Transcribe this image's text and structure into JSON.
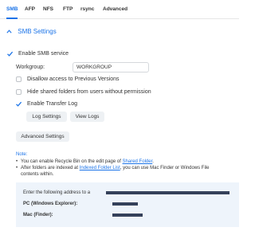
{
  "tabs": [
    {
      "label": "SMB",
      "active": true
    },
    {
      "label": "AFP",
      "active": false
    },
    {
      "label": "NFS",
      "active": false
    },
    {
      "label": "FTP",
      "active": false
    },
    {
      "label": "rsync",
      "active": false
    },
    {
      "label": "Advanced",
      "active": false
    }
  ],
  "section": {
    "title": "SMB Settings",
    "chevron_icon": "chevron-up-icon"
  },
  "settings": {
    "enable_smb": {
      "label": "Enable SMB service",
      "checked": true
    },
    "workgroup": {
      "label": "Workgroup:",
      "value": "WORKGROUP"
    },
    "disallow_previous_versions": {
      "label": "Disallow access to Previous Versions",
      "checked": false
    },
    "hide_shared_folders": {
      "label": "Hide shared folders from users without permission",
      "checked": false
    },
    "enable_transfer_log": {
      "label": "Enable Transfer Log",
      "checked": true
    },
    "log_settings_button": "Log Settings",
    "view_logs_button": "View Logs",
    "advanced_settings_button": "Advanced Settings"
  },
  "note": {
    "title": "Note:",
    "line1_prefix": "You can enable Recycle Bin on the edit page of ",
    "line1_link": "Shared Folder",
    "line1_suffix": ".",
    "line2_prefix": "After folders are indexed at ",
    "line2_link": "Indexed Folder List",
    "line2_suffix": ", you can use Mac Finder or Windows File",
    "line2_cont": "contents within."
  },
  "address_box": {
    "intro": "Enter the following address to a",
    "windows_label": "PC (Windows Explorer):",
    "mac_label": "Mac (Finder):"
  },
  "colors": {
    "accent": "#1a73e8",
    "info_bg": "#eef4fb",
    "redaction": "#35415a"
  }
}
